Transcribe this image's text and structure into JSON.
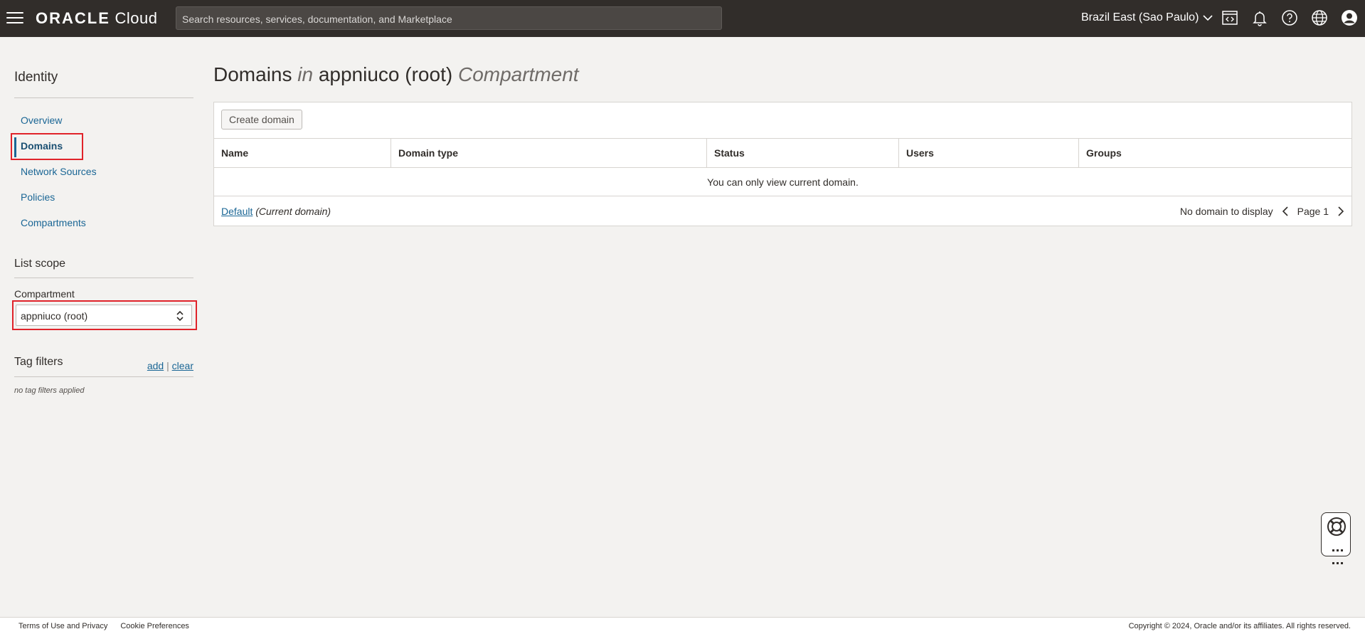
{
  "topbar": {
    "brand_oracle": "ORACLE",
    "brand_cloud": "Cloud",
    "search_placeholder": "Search resources, services, documentation, and Marketplace",
    "region": "Brazil East (Sao Paulo)",
    "icons": [
      "menu-icon",
      "code-editor-icon",
      "bell-icon",
      "help-icon",
      "globe-icon",
      "user-icon"
    ]
  },
  "sidebar": {
    "title": "Identity",
    "items": [
      {
        "label": "Overview",
        "active": false
      },
      {
        "label": "Domains",
        "active": true
      },
      {
        "label": "Network Sources",
        "active": false
      },
      {
        "label": "Policies",
        "active": false
      },
      {
        "label": "Compartments",
        "active": false
      }
    ],
    "list_scope_title": "List scope",
    "compartment_label": "Compartment",
    "compartment_value": "appniuco (root)",
    "tag_filters_title": "Tag filters",
    "tag_add": "add",
    "tag_separator": "|",
    "tag_clear": "clear",
    "no_tag_filters": "no tag filters applied"
  },
  "main": {
    "title_prefix": "Domains",
    "title_in": "in",
    "title_compartment_name": "appniuco (root)",
    "title_suffix": "Compartment",
    "create_button": "Create domain",
    "columns": [
      "Name",
      "Domain type",
      "Status",
      "Users",
      "Groups"
    ],
    "empty_message": "You can only view current domain.",
    "current_domain_link": "Default",
    "current_domain_note": "(Current domain)",
    "no_domain_text": "No domain to display",
    "page_label": "Page 1"
  },
  "footer": {
    "terms": "Terms of Use and Privacy",
    "cookies": "Cookie Preferences",
    "copyright": "Copyright © 2024, Oracle and/or its affiliates. All rights reserved."
  },
  "colors": {
    "topbar_bg": "#312d2a",
    "link": "#1a6695",
    "highlight": "#e0232a",
    "page_bg": "#f3f2f0"
  }
}
